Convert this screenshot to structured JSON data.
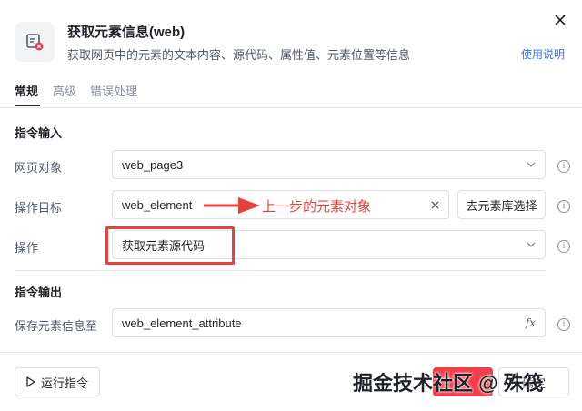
{
  "header": {
    "title": "获取元素信息(web)",
    "description": "获取网页中的元素的文本内容、源代码、属性值、元素位置等信息",
    "help_link": "使用说明"
  },
  "tabs": [
    {
      "label": "常规",
      "active": true
    },
    {
      "label": "高级",
      "active": false
    },
    {
      "label": "错误处理",
      "active": false
    }
  ],
  "input_section": {
    "title": "指令输入",
    "web_page": {
      "label": "网页对象",
      "value": "web_page3"
    },
    "target": {
      "label": "操作目标",
      "value": "web_element",
      "library_button": "去元素库选择"
    },
    "operation": {
      "label": "操作",
      "value": "获取元素源代码"
    }
  },
  "output_section": {
    "title": "指令输出",
    "save": {
      "label": "保存元素信息至",
      "value": "web_element_attribute",
      "fx": "fx"
    }
  },
  "annotation": {
    "text": "上一步的元素对象",
    "color": "#e8413b"
  },
  "footer": {
    "run_button": "运行指令",
    "save_button": "确定",
    "watermark": "掘金技术社区 @ 殊筏"
  },
  "colors": {
    "link": "#3370ff",
    "annotation": "#e8413b",
    "text": "#1f2329",
    "muted": "#4e5969"
  }
}
